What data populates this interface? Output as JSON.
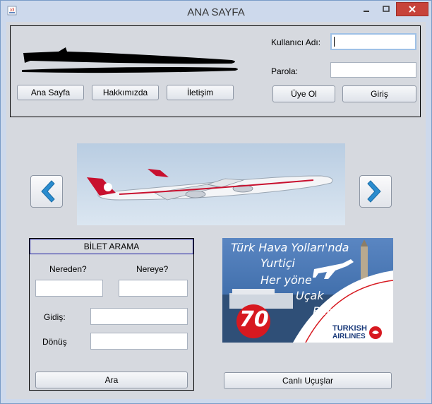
{
  "window": {
    "title": "ANA SAYFA"
  },
  "nav": {
    "home": "Ana Sayfa",
    "about": "Hakkımızda",
    "contact": "İletişim"
  },
  "login": {
    "username_label": "Kullanıcı Adı:",
    "username_value": "",
    "password_label": "Parola:",
    "password_value": "",
    "register": "Üye Ol",
    "login": "Giriş"
  },
  "search": {
    "title": "BİLET ARAMA",
    "from_label": "Nereden?",
    "to_label": "Nereye?",
    "departure_label": "Gidiş:",
    "return_label": "Dönüş",
    "search_button": "Ara"
  },
  "ad": {
    "line1": "Türk Hava Yolları'nda",
    "line2": "Yurtiçi",
    "line3": "Her yöne",
    "line4": "Uçak",
    "line5": "Bileti",
    "price": "70",
    "brand1": "TURKISH",
    "brand2": "AIRLINES"
  },
  "live_flights": "Canlı Uçuşlar",
  "icons": {
    "prev": "chevron-left-icon",
    "next": "chevron-right-icon"
  },
  "colors": {
    "accent": "#2a8ccf",
    "close": "#c7433a",
    "brand_red": "#d71920"
  }
}
